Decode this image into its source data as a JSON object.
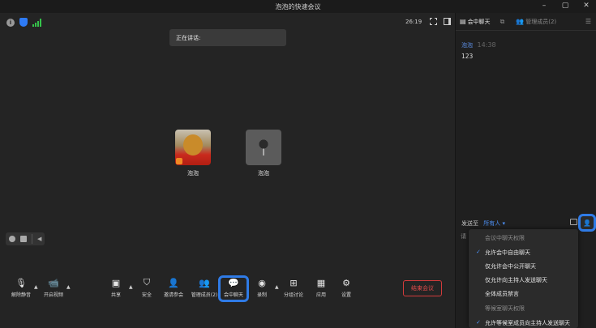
{
  "window": {
    "title": "泡泡的快速会议",
    "controls": [
      "–",
      "▢",
      "✕"
    ]
  },
  "meeting": {
    "timer": "26:19",
    "speaking_label": "正在讲话:",
    "participants": [
      {
        "name": "泡泡"
      },
      {
        "name": "泡泡"
      }
    ]
  },
  "toolbar": {
    "unmute": "解除静音",
    "start_video": "开启视频",
    "share": "共享",
    "security": "安全",
    "invite": "邀请参会",
    "manage": "管理成员(2)",
    "chat": "会中聊天",
    "record": "录制",
    "breakout": "分组讨论",
    "apps": "应用",
    "settings": "设置",
    "end": "结束会议"
  },
  "panel": {
    "tabs": [
      {
        "label": "会中聊天",
        "active": true
      },
      {
        "label": "",
        "active": false
      },
      {
        "label": "管理成员(2)",
        "active": false
      }
    ],
    "message": {
      "sender": "泡泡",
      "time": "14:38",
      "text": "123"
    },
    "send_to_label": "发送至",
    "send_to_target": "所有人 ▾",
    "input_hint": "请"
  },
  "permissions_menu": {
    "items": [
      {
        "label": "会议中聊天权限",
        "type": "header",
        "checked": false
      },
      {
        "label": "允许会中自由聊天",
        "type": "option",
        "checked": true
      },
      {
        "label": "仅允许会中公开聊天",
        "type": "option",
        "checked": false
      },
      {
        "label": "仅允许向主持人发送聊天",
        "type": "option",
        "checked": false
      },
      {
        "label": "全体成员禁言",
        "type": "option",
        "checked": false
      },
      {
        "label": "等候室聊天权限",
        "type": "header",
        "checked": false
      },
      {
        "label": "允许等候室成员向主持人发送聊天",
        "type": "option",
        "checked": true
      }
    ]
  },
  "colors": {
    "accent": "#2f7be6",
    "danger": "#e34b4b",
    "link": "#4b8df0"
  }
}
